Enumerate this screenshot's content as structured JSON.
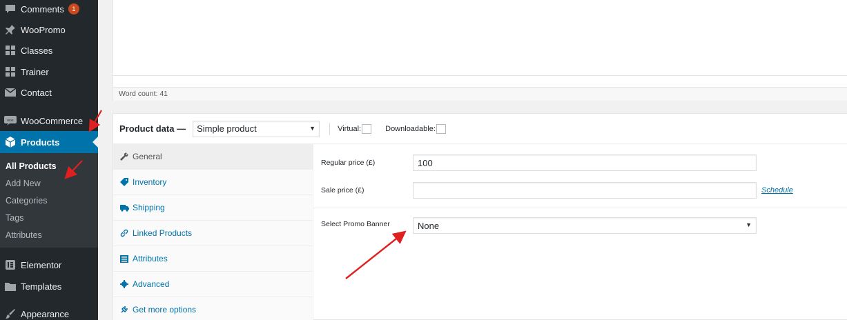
{
  "sidebar": {
    "items": [
      {
        "label": "Comments",
        "icon": "comment-icon",
        "badge": "1"
      },
      {
        "label": "WooPromo",
        "icon": "pin-icon"
      },
      {
        "label": "Classes",
        "icon": "grid-icon"
      },
      {
        "label": "Trainer",
        "icon": "grid-icon"
      },
      {
        "label": "Contact",
        "icon": "mail-icon"
      },
      {
        "label": "WooCommerce",
        "icon": "woo-icon"
      },
      {
        "label": "Products",
        "icon": "box-icon"
      },
      {
        "label": "Elementor",
        "icon": "elementor-icon"
      },
      {
        "label": "Templates",
        "icon": "folder-icon"
      },
      {
        "label": "Appearance",
        "icon": "brush-icon"
      }
    ],
    "submenu": [
      "All Products",
      "Add New",
      "Categories",
      "Tags",
      "Attributes"
    ]
  },
  "editor": {
    "word_count": "Word count: 41"
  },
  "product_data": {
    "title": "Product data —",
    "type_value": "Simple product",
    "virtual_label": "Virtual:",
    "downloadable_label": "Downloadable:",
    "tabs": [
      "General",
      "Inventory",
      "Shipping",
      "Linked Products",
      "Attributes",
      "Advanced",
      "Get more options"
    ],
    "regular_price_label": "Regular price (£)",
    "regular_price_value": "100",
    "sale_price_label": "Sale price (£)",
    "sale_price_value": "",
    "schedule_link": "Schedule",
    "promo_label": "Select Promo Banner",
    "promo_value": "None"
  },
  "colors": {
    "sidebar_bg": "#23282d",
    "active_blue": "#0073aa",
    "badge": "#ca4a1f",
    "annotation": "#e02020"
  }
}
